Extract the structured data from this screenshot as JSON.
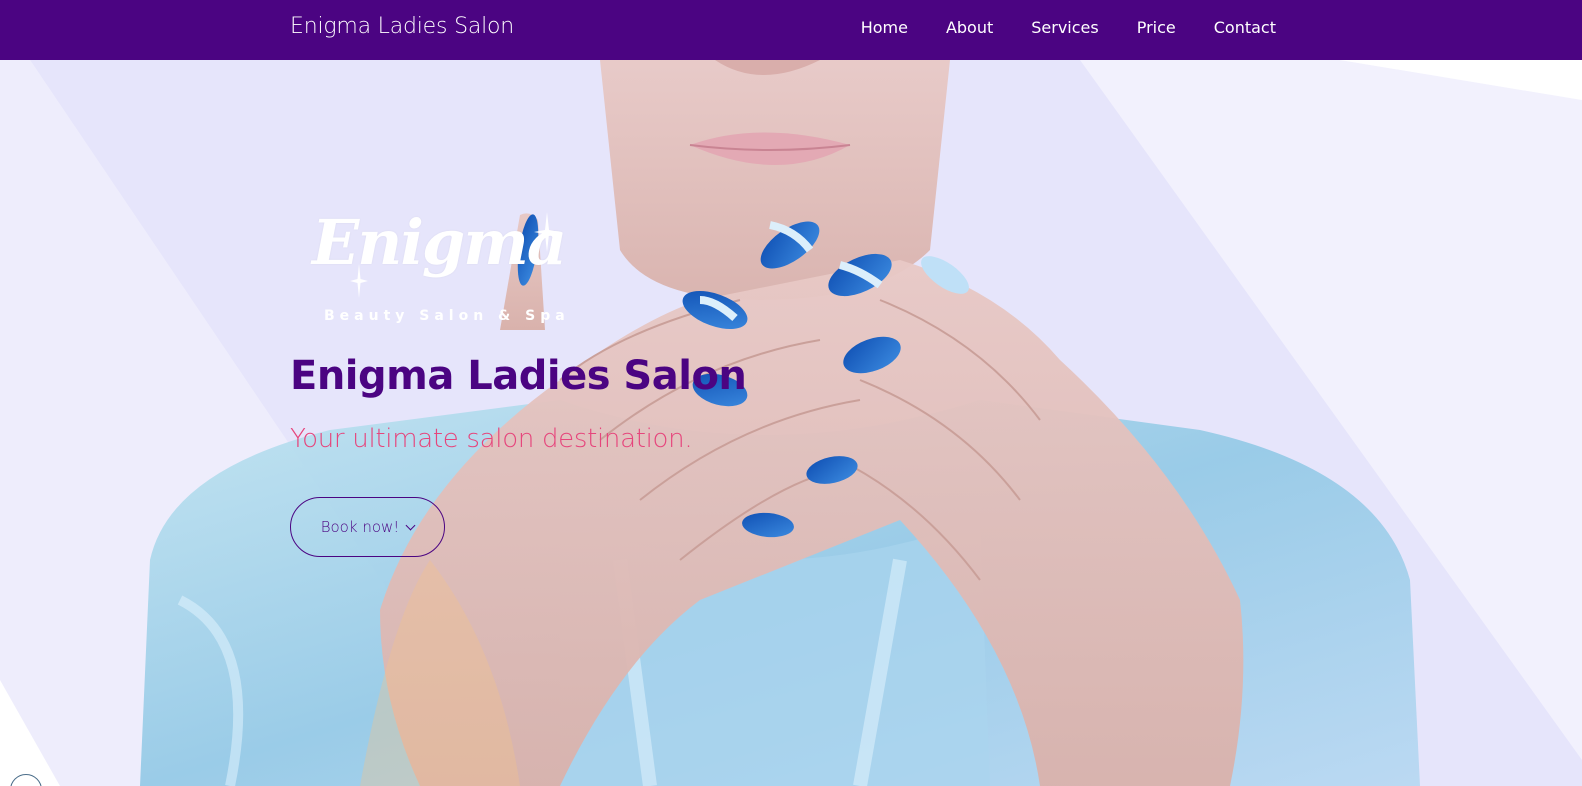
{
  "nav": {
    "brand": "Enigma Ladies Salon",
    "links": [
      "Home",
      "About",
      "Services",
      "Price",
      "Contact"
    ]
  },
  "hero": {
    "logo_script": "Enigma",
    "logo_subtitle": "Beauty Salon & Spa",
    "title": "Enigma Ladies Salon",
    "subtitle": "Your ultimate salon destination.",
    "cta_label": "Book now!"
  },
  "colors": {
    "nav_bg": "#4b0482",
    "title": "#4b0482",
    "subtitle": "#e6457c",
    "nail_blue": "#1f5fbf"
  }
}
